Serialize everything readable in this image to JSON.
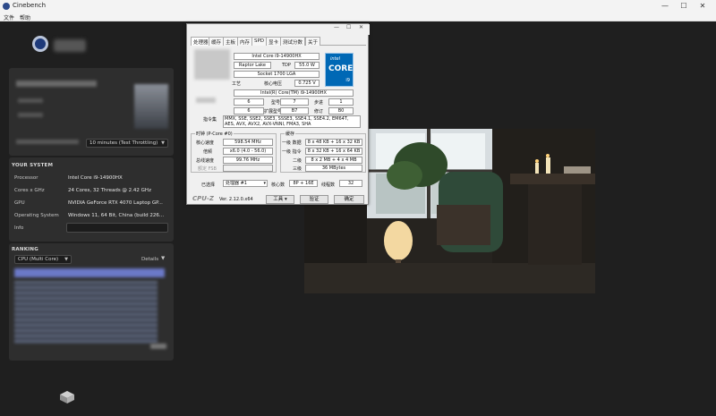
{
  "window": {
    "title": "Cinebench",
    "minimize_glyph": "—",
    "maximize_glyph": "☐",
    "close_glyph": "✕"
  },
  "menu": {
    "file": "文件",
    "help": "帮助"
  },
  "left": {
    "minimum_test_duration": {
      "selected": "10 minutes (Test Throttling)"
    },
    "system": {
      "heading": "YOUR SYSTEM",
      "rows": [
        {
          "label": "Processor",
          "value": "Intel Core i9-14900HX"
        },
        {
          "label": "Cores x GHz",
          "value": "24 Cores, 32 Threads @ 2.42 GHz"
        },
        {
          "label": "GPU",
          "value": "NVIDIA GeForce RTX 4070 Laptop GP..."
        },
        {
          "label": "Operating System",
          "value": "Windows 11, 64 Bit, China (build 226..."
        },
        {
          "label": "Info",
          "value": ""
        }
      ]
    },
    "ranking": {
      "heading": "RANKING",
      "selected": "CPU (Multi Core)",
      "details_label": "Details"
    }
  },
  "cpuz": {
    "window_title": "",
    "tabs": [
      "处理器",
      "缓存",
      "主板",
      "内存",
      "SPD",
      "显卡",
      "测试分数",
      "关于"
    ],
    "name": "Intel Core i9-14900HX",
    "codename": "Raptor Lake",
    "tdp_label": "TDP",
    "tdp": "55.0 W",
    "package": "Socket 1700 LGA",
    "tech_label": "工艺",
    "voltage_label": "核心电压",
    "voltage": "0.725 V",
    "spec": "Intel(R) Core(TM) i9-14900HX",
    "family_label": "系列",
    "family": "6",
    "model_label": "型号",
    "model": "7",
    "stepping_label": "步进",
    "stepping": "1",
    "ext_family_label": "扩展系列",
    "ext_family": "6",
    "ext_model_label": "扩展型号",
    "ext_model": "B7",
    "revision_label": "修订",
    "revision": "B0",
    "instructions_label": "指令集",
    "instructions": "MMX, SSE, SSE2, SSE3, SSSE3, SSE4.1, SSE4.2, EM64T, AES, AVX, AVX2, AVX-VNNI, FMA3, SHA",
    "clocks_group": "时钟 (P-Core #0)",
    "core_speed_label": "核心速度",
    "core_speed": "598.54 MHz",
    "multiplier_label": "倍频",
    "multiplier": "x6.0 (4.0 - 56.0)",
    "bus_speed_label": "总线速度",
    "bus_speed": "99.76 MHz",
    "rated_fsb_label": "额定 FSB",
    "cache_group": "缓存",
    "l1d_label": "一级 数据",
    "l1d": "8 x 48 KB + 16 x 32 KB",
    "l1i_label": "一级 指令",
    "l1i": "8 x 32 KB + 16 x 64 KB",
    "l2_label": "二级",
    "l2": "8 x 2 MB + 4 x 4 MB",
    "l3_label": "三级",
    "l3": "36 MBytes",
    "selection_label": "已选择",
    "selection": "处理器 #1",
    "cores_label": "核心数",
    "cores": "8P + 16E",
    "threads_label": "线程数",
    "threads": "32",
    "brand": "CPU-Z",
    "version": "Ver. 2.12.0.x64",
    "tools_label": "工具",
    "validate_label": "验证",
    "ok_label": "确定",
    "badge": {
      "intel": "intel",
      "core": "CORE",
      "tier": "i9"
    }
  },
  "colors": {
    "accent": "#0068b5",
    "panel": "#2e2e2e",
    "background": "#1f1f1f"
  }
}
